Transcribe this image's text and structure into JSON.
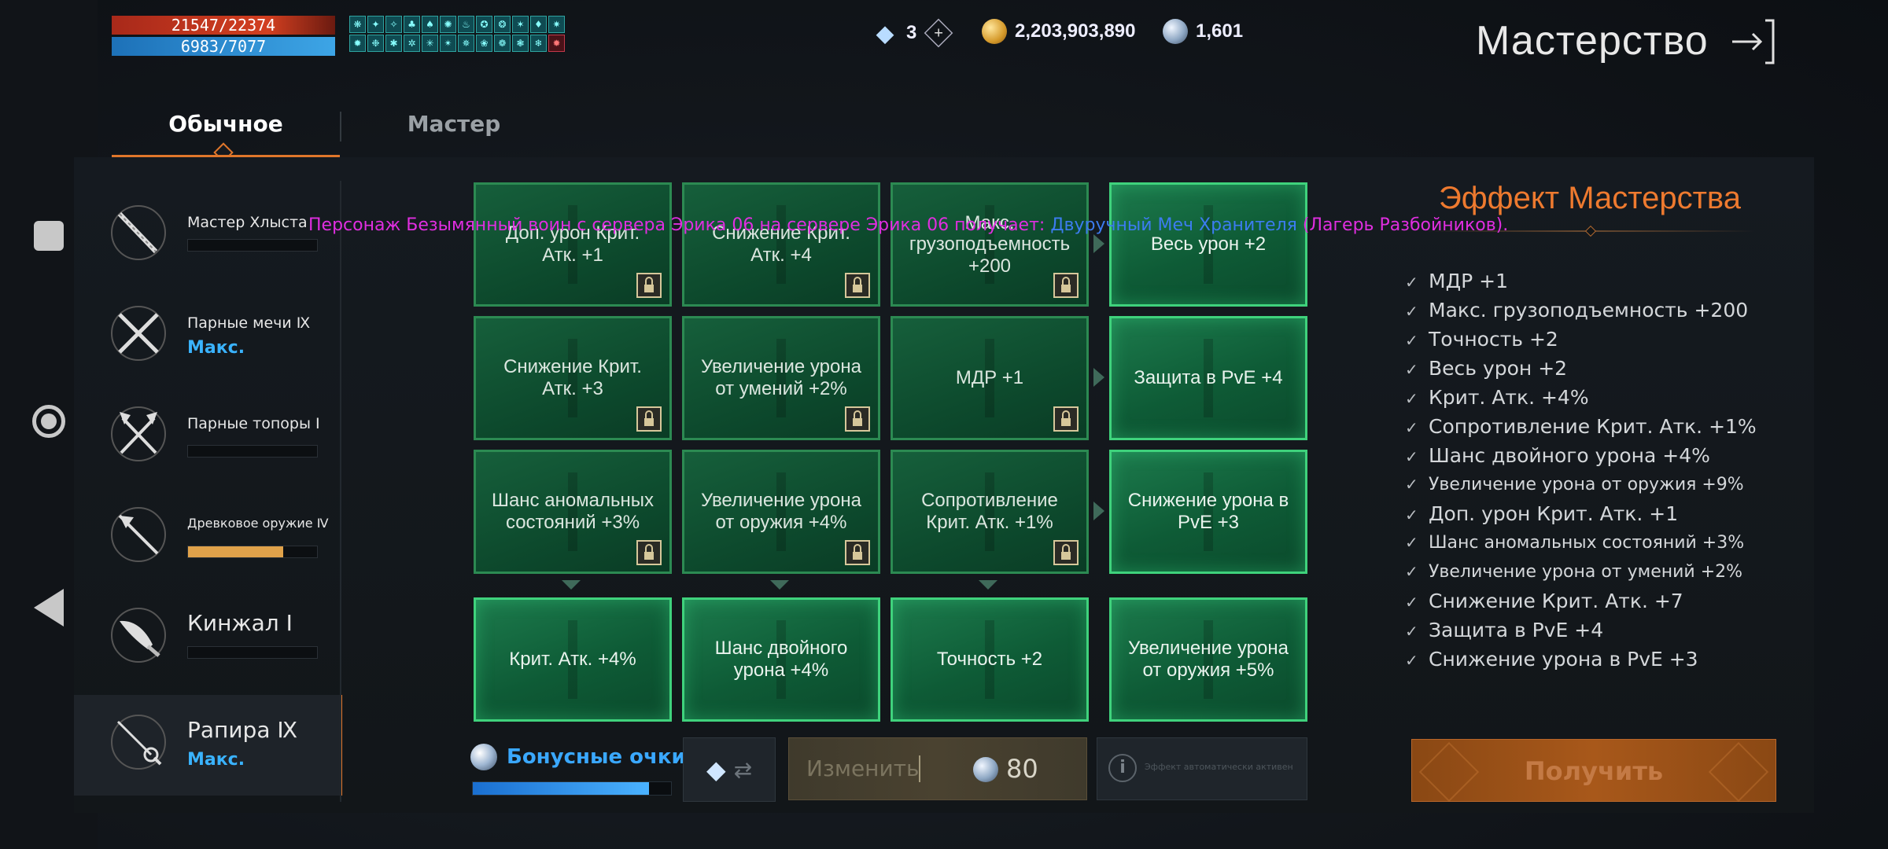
{
  "status": {
    "hp": "21547/22374",
    "hp_fill": 0.963,
    "mp": "6983/7077",
    "mp_fill": 0.987
  },
  "currency": {
    "diamonds": "3",
    "gold": "2,203,903,890",
    "orbs": "1,601"
  },
  "header": {
    "title": "Мастерство"
  },
  "tabs": [
    {
      "label": "Обычное",
      "active": true
    },
    {
      "label": "Мастер",
      "active": false
    }
  ],
  "weapons": [
    {
      "name": "Мастер Хлыста",
      "progress": 0,
      "max_label": ""
    },
    {
      "name": "Парные мечи Ⅸ",
      "progress": null,
      "max_label": "Макс."
    },
    {
      "name": "Парные топоры Ⅰ",
      "progress": 0,
      "max_label": ""
    },
    {
      "name": "Древковое оружие Ⅳ",
      "progress": 0.74,
      "max_label": ""
    },
    {
      "name": "Кинжал Ⅰ",
      "progress": 0,
      "max_label": ""
    },
    {
      "name": "Рапира Ⅸ",
      "progress": null,
      "max_label": "Макс.",
      "selected": true
    }
  ],
  "system_message": {
    "part1": "Персонаж Безымянный воин с сервера Эрика 06 на сервере Эрика 06 получает: ",
    "part2": "Двуручный Меч Хранителя",
    "part3": " (Лагерь Разбойников)."
  },
  "grid": [
    [
      "Доп. урон Крит. Атк. +1",
      "Снижение Крит. Атк. +4",
      "Макс. грузоподъемность +200",
      "Весь урон +2"
    ],
    [
      "Снижение Крит. Атк. +3",
      "Увеличение урона от умений +2%",
      "МДР +1",
      "Защита в PvE +4"
    ],
    [
      "Шанс аномальных состояний +3%",
      "Увеличение урона от оружия +4%",
      "Сопротивление Крит. Атк. +1%",
      "Снижение урона в PvE +3"
    ],
    [
      "Крит. Атк. +4%",
      "Шанс двойного урона +4%",
      "Точность +2",
      "Увеличение урона от оружия +5%"
    ]
  ],
  "effects": {
    "title": "Эффект Мастерства",
    "items": [
      "МДР +1",
      "Макс. грузоподъемность +200",
      "Точность +2",
      "Весь урон +2",
      "Крит. Атк. +4%",
      "Сопротивление Крит. Атк. +1%",
      "Шанс двойного урона +4%",
      "Увеличение урона от оружия   +9%",
      "Доп. урон Крит. Атк. +1",
      "Шанс аномальных состояний   +3%",
      "Увеличение урона от умений    +2%",
      "Снижение Крит. Атк. +7",
      "Защита в PvE +4",
      "Снижение урона в PvE +3"
    ]
  },
  "bottom": {
    "bonus_label": "Бонусные очки",
    "bonus_fill": 0.89,
    "change_label": "Изменить",
    "change_cost": "80",
    "info_text": "Эффект автоматически активен",
    "receive_label": "Получить"
  },
  "colors": {
    "accent": "#e0762b",
    "max_blue": "#3ab3ff",
    "card_green": "#1c7a4c",
    "msg_magenta": "#e02ee0",
    "msg_blue": "#3c7cf0"
  }
}
